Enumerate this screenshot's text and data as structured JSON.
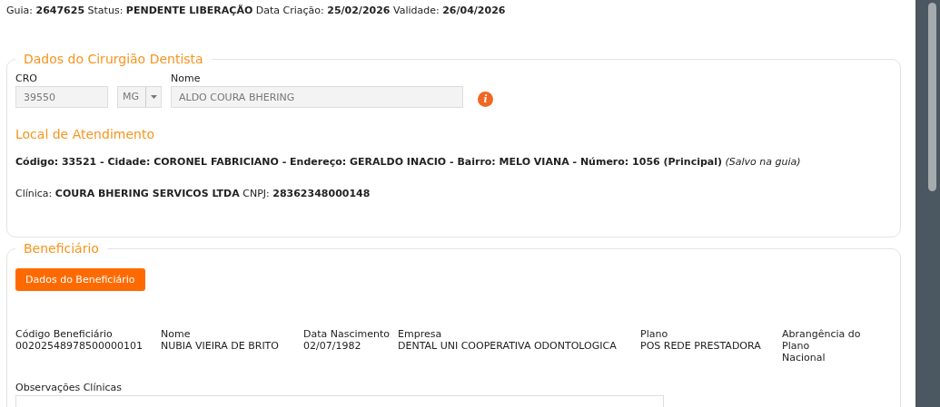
{
  "header": {
    "text": "Guia: **2647625** Status: **PENDENTE LIBERAÇÃO** Data Criação: **25/02/2026** Validade: **26/04/2026**"
  },
  "dentist_section": {
    "legend": "Dados do Cirurgião Dentista",
    "cro": {
      "label": "CRO",
      "value": "39550",
      "disabled": true
    },
    "uf": {
      "value": "MG",
      "disabled": true
    },
    "name": {
      "label": "Nome",
      "value": "ALDO COURA BHERING",
      "disabled": true
    },
    "info_icon": {
      "glyph": "i"
    },
    "location": {
      "title": "Local de Atendimento",
      "address": "**Código: 33521 - Cidade: CORONEL FABRICIANO - Endereço: GERALDO INACIO - Bairro: MELO VIANA - Número: 1056 (Principal)** *(Salvo na guia)*",
      "clinic": "Clínica: **COURA BHERING SERVICOS LTDA** CNPJ: **28362348000148**"
    }
  },
  "beneficiary_section": {
    "legend": "Beneficiário",
    "button": "Dados do Beneficiário",
    "fields": [
      {
        "label": "Código Beneficiário",
        "value": "00202548978500000101"
      },
      {
        "label": "Nome",
        "value": "NUBIA VIEIRA DE BRITO"
      },
      {
        "label": "Data Nascimento",
        "value": "02/07/1982"
      },
      {
        "label": "Empresa",
        "value": "DENTAL UNI COOPERATIVA ODONTOLOGICA"
      },
      {
        "label": "Plano",
        "value": "POS REDE PRESTADORA"
      },
      {
        "label": "Abrangência do Plano",
        "value": "Nacional"
      }
    ],
    "notes": {
      "label": "Observações Clínicas"
    }
  }
}
